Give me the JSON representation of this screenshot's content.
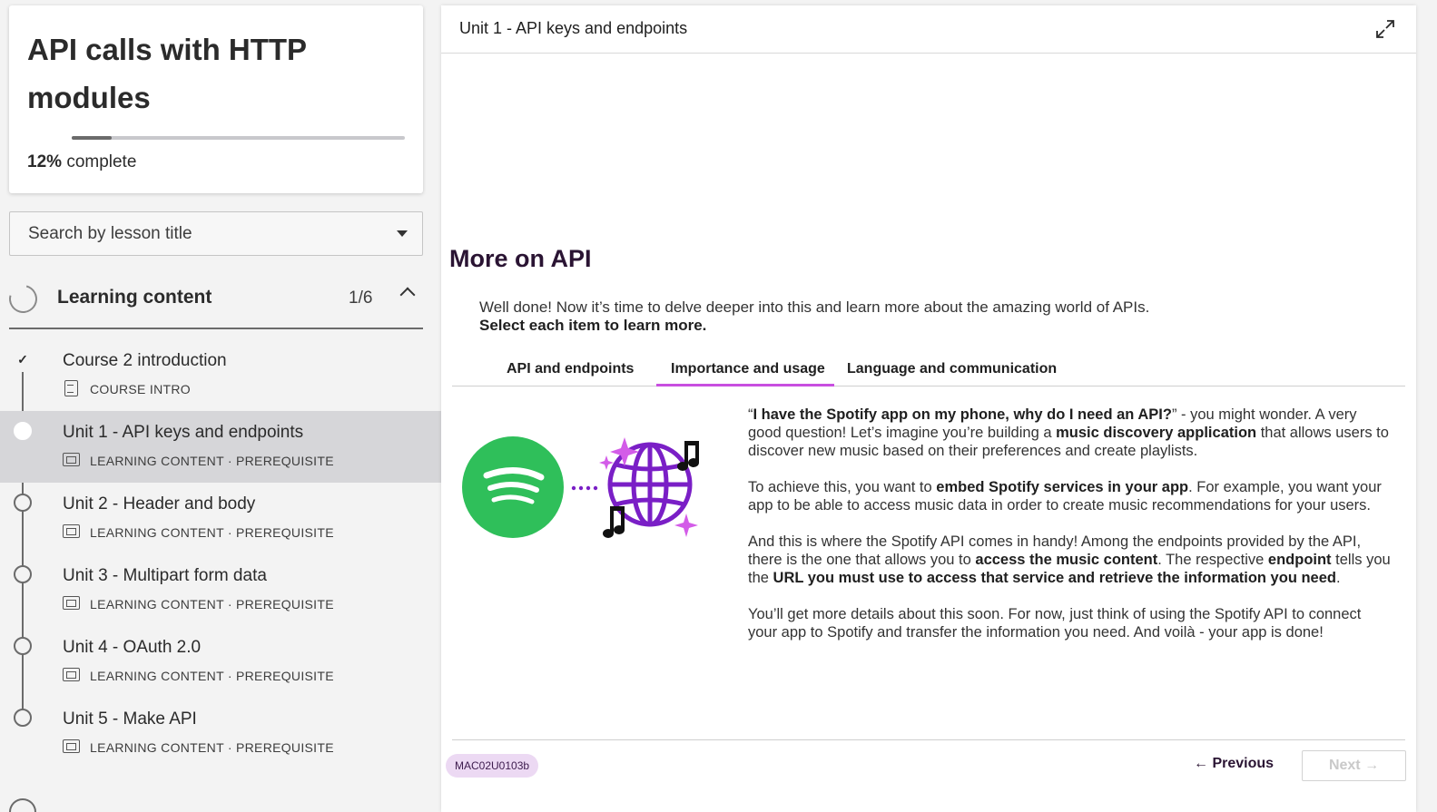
{
  "course": {
    "title": "API calls with HTTP modules",
    "progress_percent": "12%",
    "progress_value": 0.12,
    "progress_suffix": "complete"
  },
  "search": {
    "placeholder": "Search by lesson title"
  },
  "section": {
    "title": "Learning content",
    "count": "1/6"
  },
  "lessons": [
    {
      "title": "Course 2 introduction",
      "meta": "COURSE INTRO",
      "status": "completed"
    },
    {
      "title": "Unit 1 - API keys and endpoints",
      "meta": "LEARNING CONTENT · PREREQUISITE",
      "status": "active"
    },
    {
      "title": "Unit 2 - Header and body",
      "meta": "LEARNING CONTENT · PREREQUISITE",
      "status": "not-started"
    },
    {
      "title": "Unit 3 - Multipart form data",
      "meta": "LEARNING CONTENT · PREREQUISITE",
      "status": "not-started"
    },
    {
      "title": "Unit 4 - OAuth 2.0",
      "meta": "LEARNING CONTENT · PREREQUISITE",
      "status": "not-started"
    },
    {
      "title": "Unit 5 - Make API",
      "meta": "LEARNING CONTENT · PREREQUISITE",
      "status": "not-started"
    }
  ],
  "main": {
    "header_title": "Unit 1 - API keys and endpoints",
    "heading": "More on API",
    "intro_line": "Well done! Now it’s time to delve deeper into this and learn more about the amazing world of APIs.",
    "intro_bold": "Select each item to learn more.",
    "tabs": [
      {
        "label": "API and endpoints"
      },
      {
        "label": "Importance and usage"
      },
      {
        "label": "Language and communication"
      }
    ],
    "active_tab": 1,
    "paragraphs": {
      "p1": [
        {
          "t": "“"
        },
        {
          "b": "I have the Spotify app on my phone, why do I need an API?"
        },
        {
          "t": "” - you might wonder. A very good question! Let’s imagine you’re building a "
        },
        {
          "b": "music discovery application"
        },
        {
          "t": " that allows users to discover new music based on their preferences and create playlists."
        }
      ],
      "p2": [
        {
          "t": "To achieve this, you want to "
        },
        {
          "b": "embed Spotify services in your app"
        },
        {
          "t": ". For example, you want your app to be able to access music data in order to create music recommendations for your users."
        }
      ],
      "p3": [
        {
          "t": "And this is where the Spotify API comes in handy! Among the endpoints provided by the API, there is the one that allows you to "
        },
        {
          "b": "access the music content"
        },
        {
          "t": ". The respective "
        },
        {
          "b": "endpoint"
        },
        {
          "t": " tells you the "
        },
        {
          "b": "URL you must use to access that service and retrieve the information you need"
        },
        {
          "t": "."
        }
      ],
      "p4": [
        {
          "t": "You’ll get more details about this soon. For now, just think of using the Spotify API to connect your app to Spotify and transfer the information you need. And voilà - your app is done!"
        }
      ]
    },
    "tag": "MAC02U0103b",
    "prev_label": "← Previous",
    "next_label": "Next →"
  },
  "colors": {
    "accent": "#c84fe0",
    "spotify_green": "#2fbf5a",
    "globe_purple": "#7a1fc6",
    "sparkle": "#d35ce8",
    "heading": "#2a1433"
  }
}
